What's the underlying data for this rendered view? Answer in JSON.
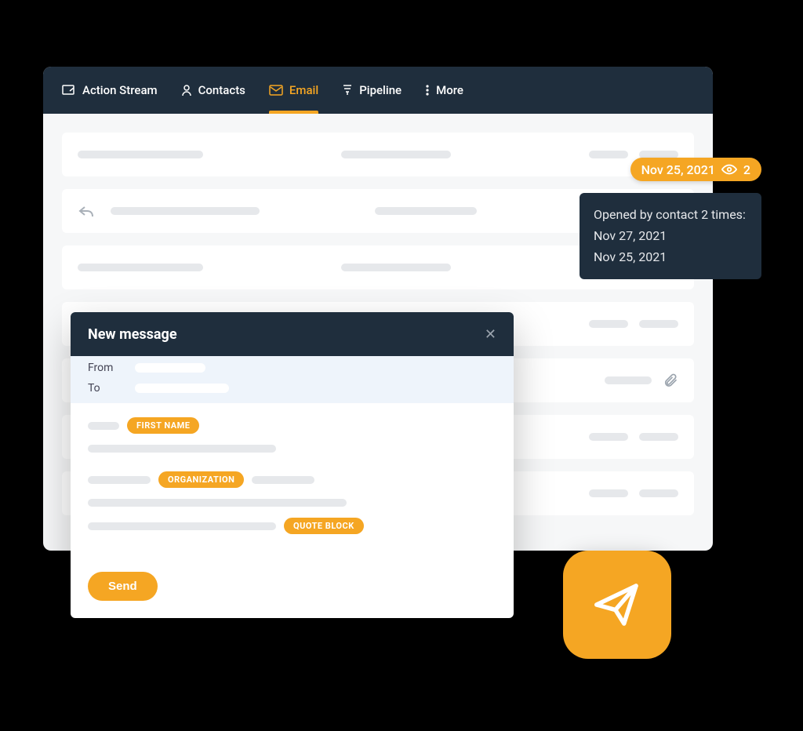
{
  "nav": {
    "action_stream": "Action Stream",
    "contacts": "Contacts",
    "email": "Email",
    "pipeline": "Pipeline",
    "more": "More"
  },
  "open_tracking": {
    "date": "Nov 25, 2021",
    "count": "2",
    "tooltip_title": "Opened by contact 2 times:",
    "times": [
      "Nov 27, 2021",
      "Nov 25, 2021"
    ]
  },
  "composer": {
    "title": "New message",
    "from_label": "From",
    "to_label": "To",
    "tag_first_name": "FIRST NAME",
    "tag_organization": "ORGANIZATION",
    "tag_quote_block": "QUOTE BLOCK",
    "send_label": "Send"
  }
}
